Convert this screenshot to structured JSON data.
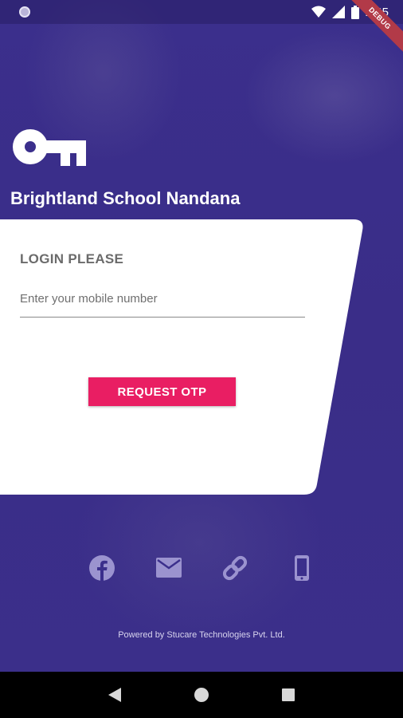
{
  "status_bar": {
    "time": "2:45",
    "debug_label": "DEBUG",
    "icons": [
      "notification-dot-icon",
      "wifi-icon",
      "signal-icon",
      "battery-icon"
    ]
  },
  "app": {
    "logo_icon": "key-icon",
    "school_name": "Brightland School Nandana"
  },
  "login_card": {
    "title": "LOGIN PLEASE",
    "mobile_input": {
      "placeholder": "Enter your mobile number",
      "value": ""
    },
    "request_otp_label": "REQUEST OTP"
  },
  "social_links": [
    {
      "icon": "facebook-icon"
    },
    {
      "icon": "email-icon"
    },
    {
      "icon": "link-icon"
    },
    {
      "icon": "phone-icon"
    }
  ],
  "footer": {
    "powered_by": "Powered by Stucare Technologies Pvt. Ltd."
  },
  "nav_bar": {
    "buttons": [
      "back-icon",
      "home-icon",
      "recents-icon"
    ]
  },
  "colors": {
    "background": "#3a2e8a",
    "accent": "#e91e63",
    "card": "#ffffff",
    "icon_muted": "#9b93cf"
  }
}
